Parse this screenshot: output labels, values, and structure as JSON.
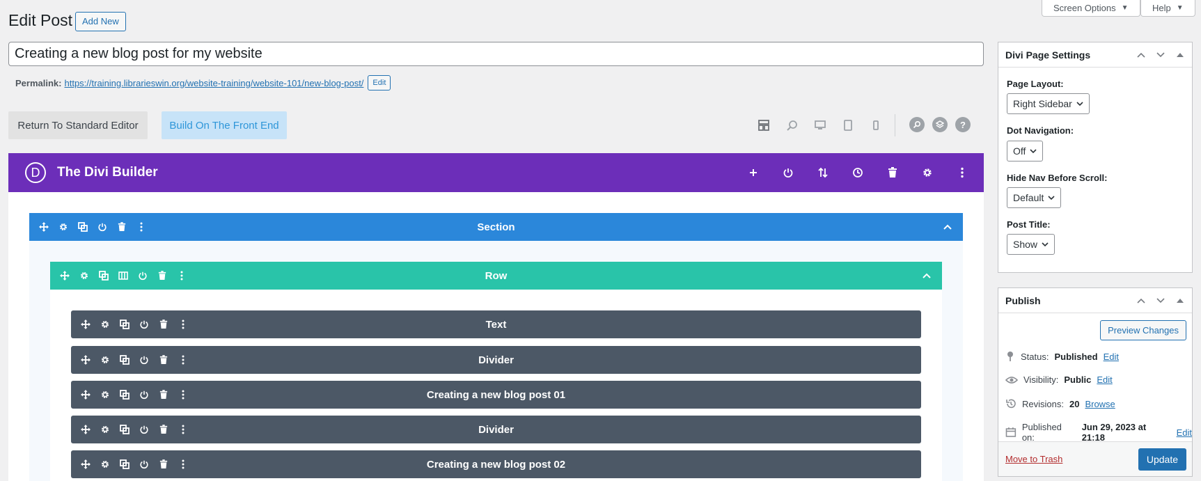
{
  "header": {
    "title": "Edit Post",
    "add_new": "Add New",
    "screen_options": "Screen Options",
    "help": "Help"
  },
  "post": {
    "title": "Creating a new blog post for my website",
    "permalink_label": "Permalink:",
    "permalink_url": "https://training.librarieswin.org/website-training/website-101/new-blog-post/",
    "permalink_edit": "Edit"
  },
  "editor_buttons": {
    "standard": "Return To Standard Editor",
    "front_end": "Build On The Front End"
  },
  "toolbar_icons": [
    "layout-icon",
    "zoom-icon",
    "desktop-icon",
    "tablet-icon",
    "phone-icon",
    "search-icon",
    "layers-icon",
    "help-icon"
  ],
  "builder": {
    "title": "The Divi Builder",
    "logo_letter": "D",
    "header_icons": [
      "plus-icon",
      "power-icon",
      "sort-icon",
      "history-icon",
      "trash-icon",
      "gear-icon",
      "more-icon"
    ],
    "section_label": "Section",
    "row_label": "Row",
    "modules": [
      "Text",
      "Divider",
      "Creating a new blog post 01",
      "Divider",
      "Creating a new blog post 02"
    ]
  },
  "divi_settings": {
    "title": "Divi Page Settings",
    "page_layout_label": "Page Layout:",
    "page_layout_value": "Right Sidebar",
    "dot_nav_label": "Dot Navigation:",
    "dot_nav_value": "Off",
    "hide_nav_label": "Hide Nav Before Scroll:",
    "hide_nav_value": "Default",
    "post_title_label": "Post Title:",
    "post_title_value": "Show"
  },
  "publish": {
    "title": "Publish",
    "preview": "Preview Changes",
    "status_label": "Status:",
    "status_value": "Published",
    "status_edit": "Edit",
    "visibility_label": "Visibility:",
    "visibility_value": "Public",
    "visibility_edit": "Edit",
    "revisions_label": "Revisions:",
    "revisions_value": "20",
    "revisions_browse": "Browse",
    "published_label": "Published on:",
    "published_value": "Jun 29, 2023 at 21:18",
    "published_edit": "Edit",
    "trash": "Move to Trash",
    "update": "Update"
  },
  "colors": {
    "builder_header": "#6c2eb9",
    "section": "#2b87da",
    "row": "#29c4a9",
    "module": "#4c5866",
    "wp_blue": "#2271b1"
  }
}
